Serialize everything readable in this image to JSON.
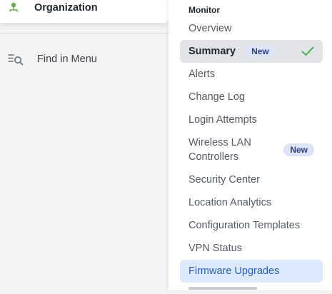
{
  "header": {
    "title": "Organization",
    "icon": "organization-icon",
    "icon_color": "#6aa84f"
  },
  "search": {
    "label": "Find in Menu",
    "icon": "menu-search-icon"
  },
  "menu": {
    "section_title": "Monitor",
    "items": [
      {
        "label": "Overview"
      },
      {
        "label": "Summary",
        "badge": "New",
        "selected": true
      },
      {
        "label": "Alerts"
      },
      {
        "label": "Change Log"
      },
      {
        "label": "Login Attempts"
      },
      {
        "label_line1": "Wireless LAN",
        "label_line2": "Controllers",
        "badge": "New"
      },
      {
        "label": "Security Center"
      },
      {
        "label": "Location Analytics"
      },
      {
        "label": "Configuration Templates"
      },
      {
        "label": "VPN Status"
      },
      {
        "label": "Firmware Upgrades",
        "hovered": true
      }
    ]
  },
  "colors": {
    "selected_bg": "#e2e4e8",
    "hover_bg": "#dce8fb",
    "hover_text": "#2a5fb8",
    "badge_bg": "#dde4f7",
    "badge_text": "#2b3f8a",
    "check": "#4caf50"
  }
}
